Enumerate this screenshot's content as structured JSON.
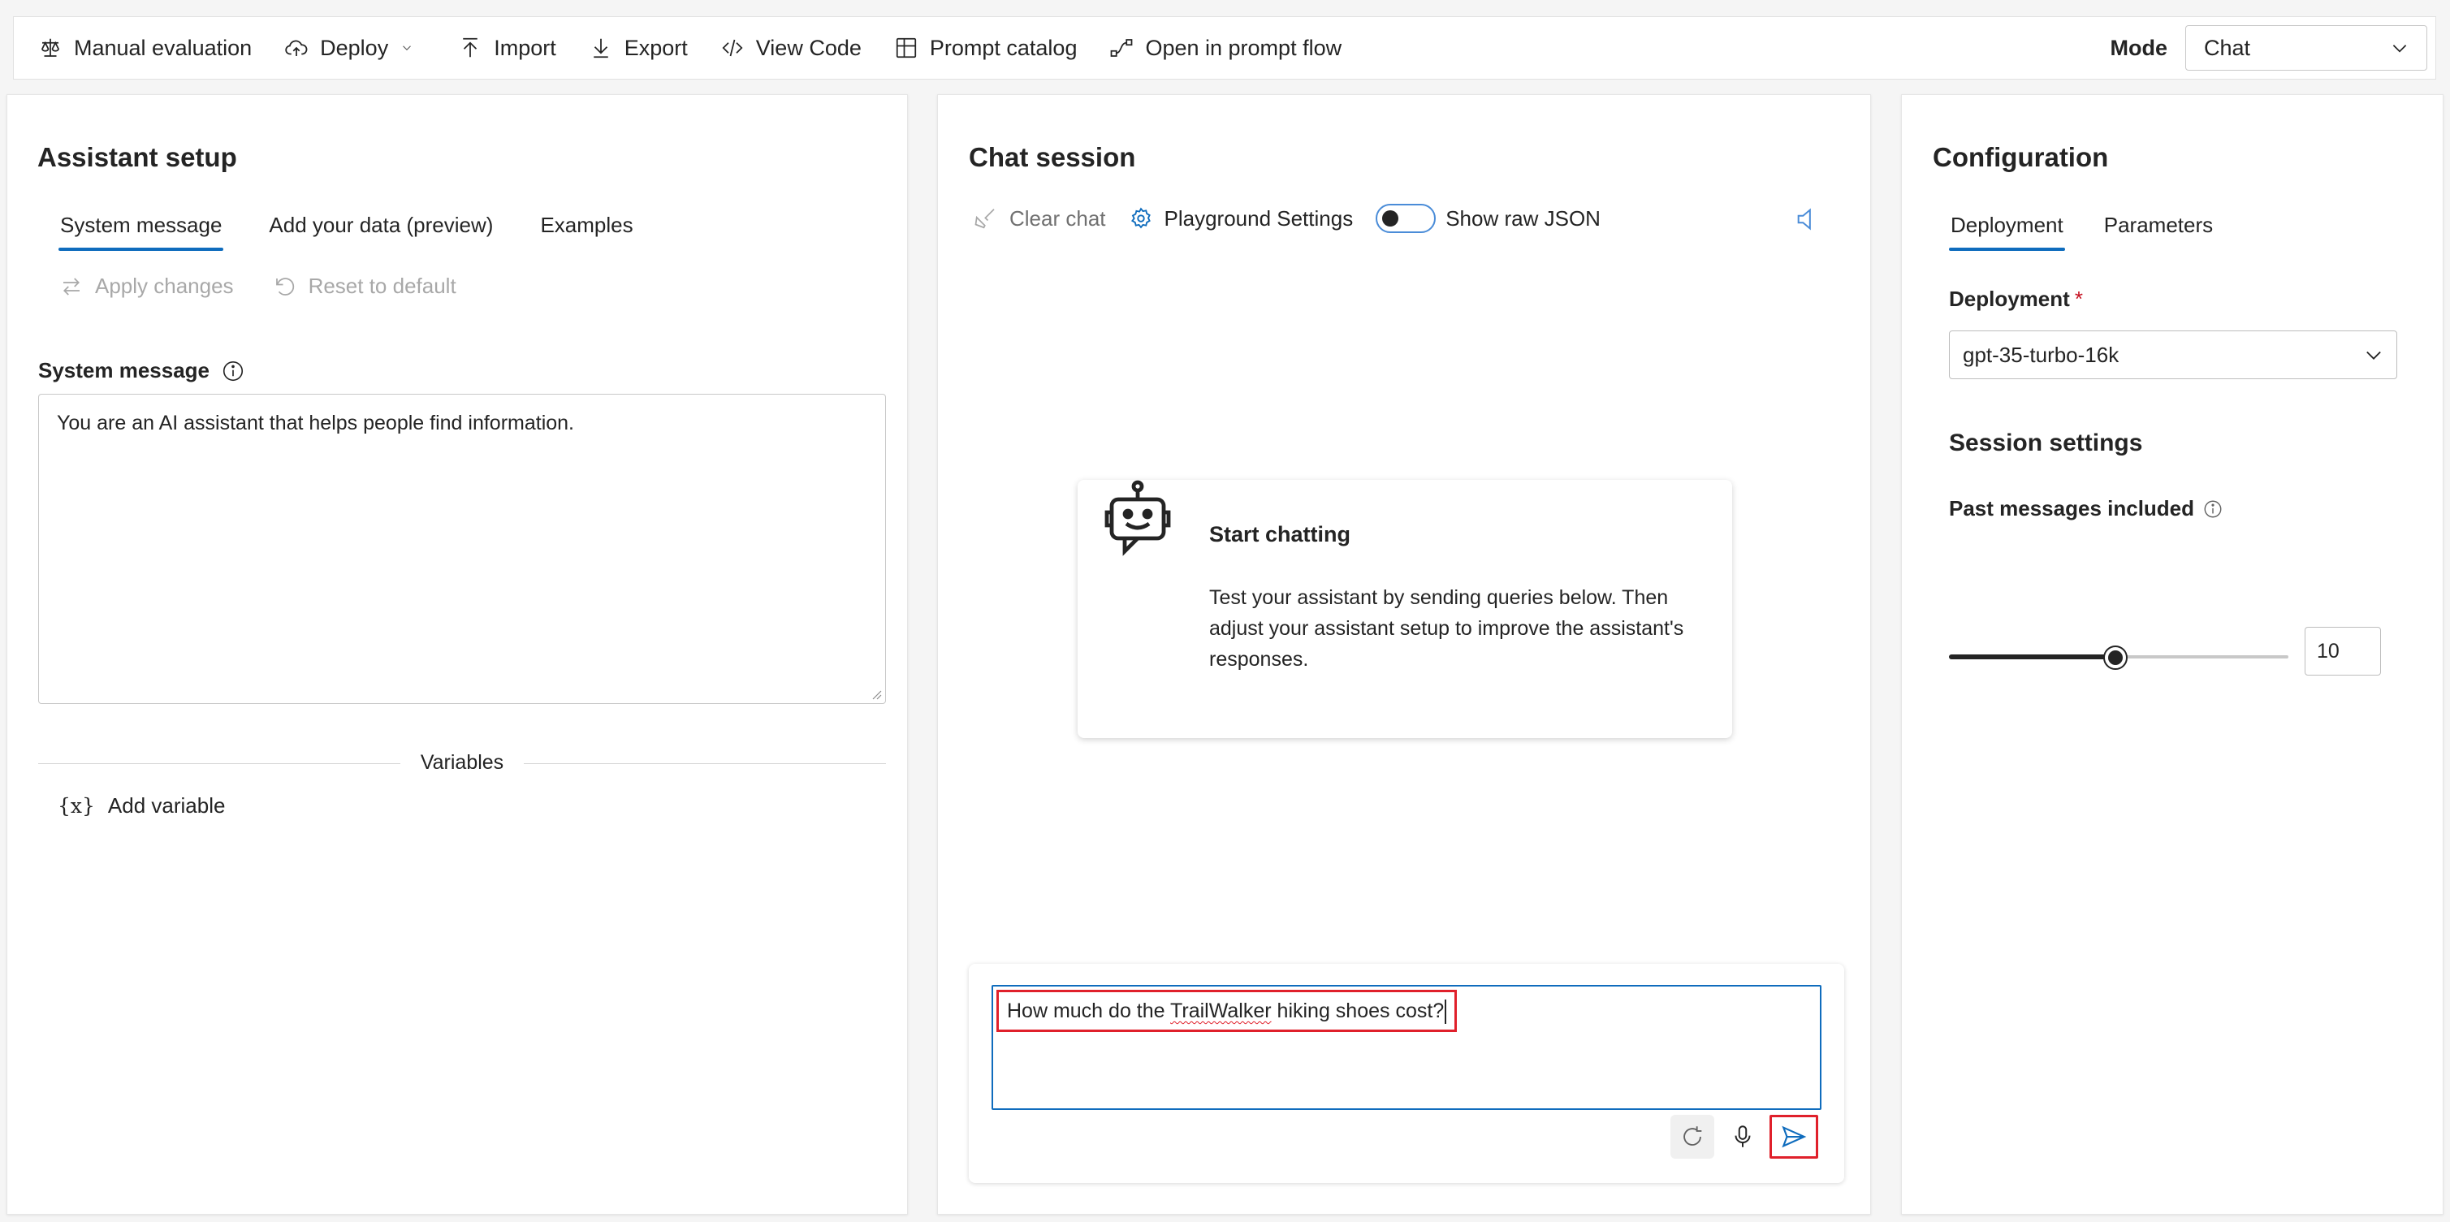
{
  "toolbar": {
    "items": [
      {
        "label": "Manual evaluation",
        "icon": "scale-icon"
      },
      {
        "label": "Deploy",
        "icon": "cloud-upload-icon"
      },
      {
        "label": "Import",
        "icon": "arrow-upload-icon"
      },
      {
        "label": "Export",
        "icon": "arrow-download-icon"
      },
      {
        "label": "View Code",
        "icon": "code-icon"
      },
      {
        "label": "Prompt catalog",
        "icon": "grid-icon"
      },
      {
        "label": "Open in prompt flow",
        "icon": "flow-icon"
      }
    ],
    "mode_label": "Mode",
    "mode_value": "Chat"
  },
  "assistant_setup": {
    "title": "Assistant setup",
    "tabs": [
      {
        "label": "System message",
        "active": true
      },
      {
        "label": "Add your data (preview)",
        "active": false
      },
      {
        "label": "Examples",
        "active": false
      }
    ],
    "apply_changes": "Apply changes",
    "reset_to_default": "Reset to default",
    "system_message_label": "System message",
    "system_message_value": "You are an AI assistant that helps people find information.",
    "variables_label": "Variables",
    "add_variable": "Add variable",
    "add_variable_glyph": "{x}"
  },
  "chat_session": {
    "title": "Chat session",
    "clear_chat": "Clear chat",
    "playground_settings": "Playground Settings",
    "show_raw_json": "Show raw JSON",
    "show_raw_json_on": false,
    "start_title": "Start chatting",
    "start_body": "Test your assistant by sending queries below. Then adjust your assistant setup to improve the assistant's responses.",
    "input": {
      "prefix": "How much do the ",
      "misspelled": "TrailWalker",
      "suffix": " hiking shoes cost?"
    }
  },
  "configuration": {
    "title": "Configuration",
    "tabs": [
      {
        "label": "Deployment",
        "active": true
      },
      {
        "label": "Parameters",
        "active": false
      }
    ],
    "deployment_label": "Deployment",
    "required_mark": "*",
    "deployment_value": "gpt-35-turbo-16k",
    "session_settings_title": "Session settings",
    "past_messages_label": "Past messages included",
    "past_messages_value": "10",
    "past_messages_fraction": 0.49
  },
  "colors": {
    "accent": "#0f6cbd",
    "highlight_border": "#e0202b",
    "disabled_text": "#a8a8a8"
  }
}
